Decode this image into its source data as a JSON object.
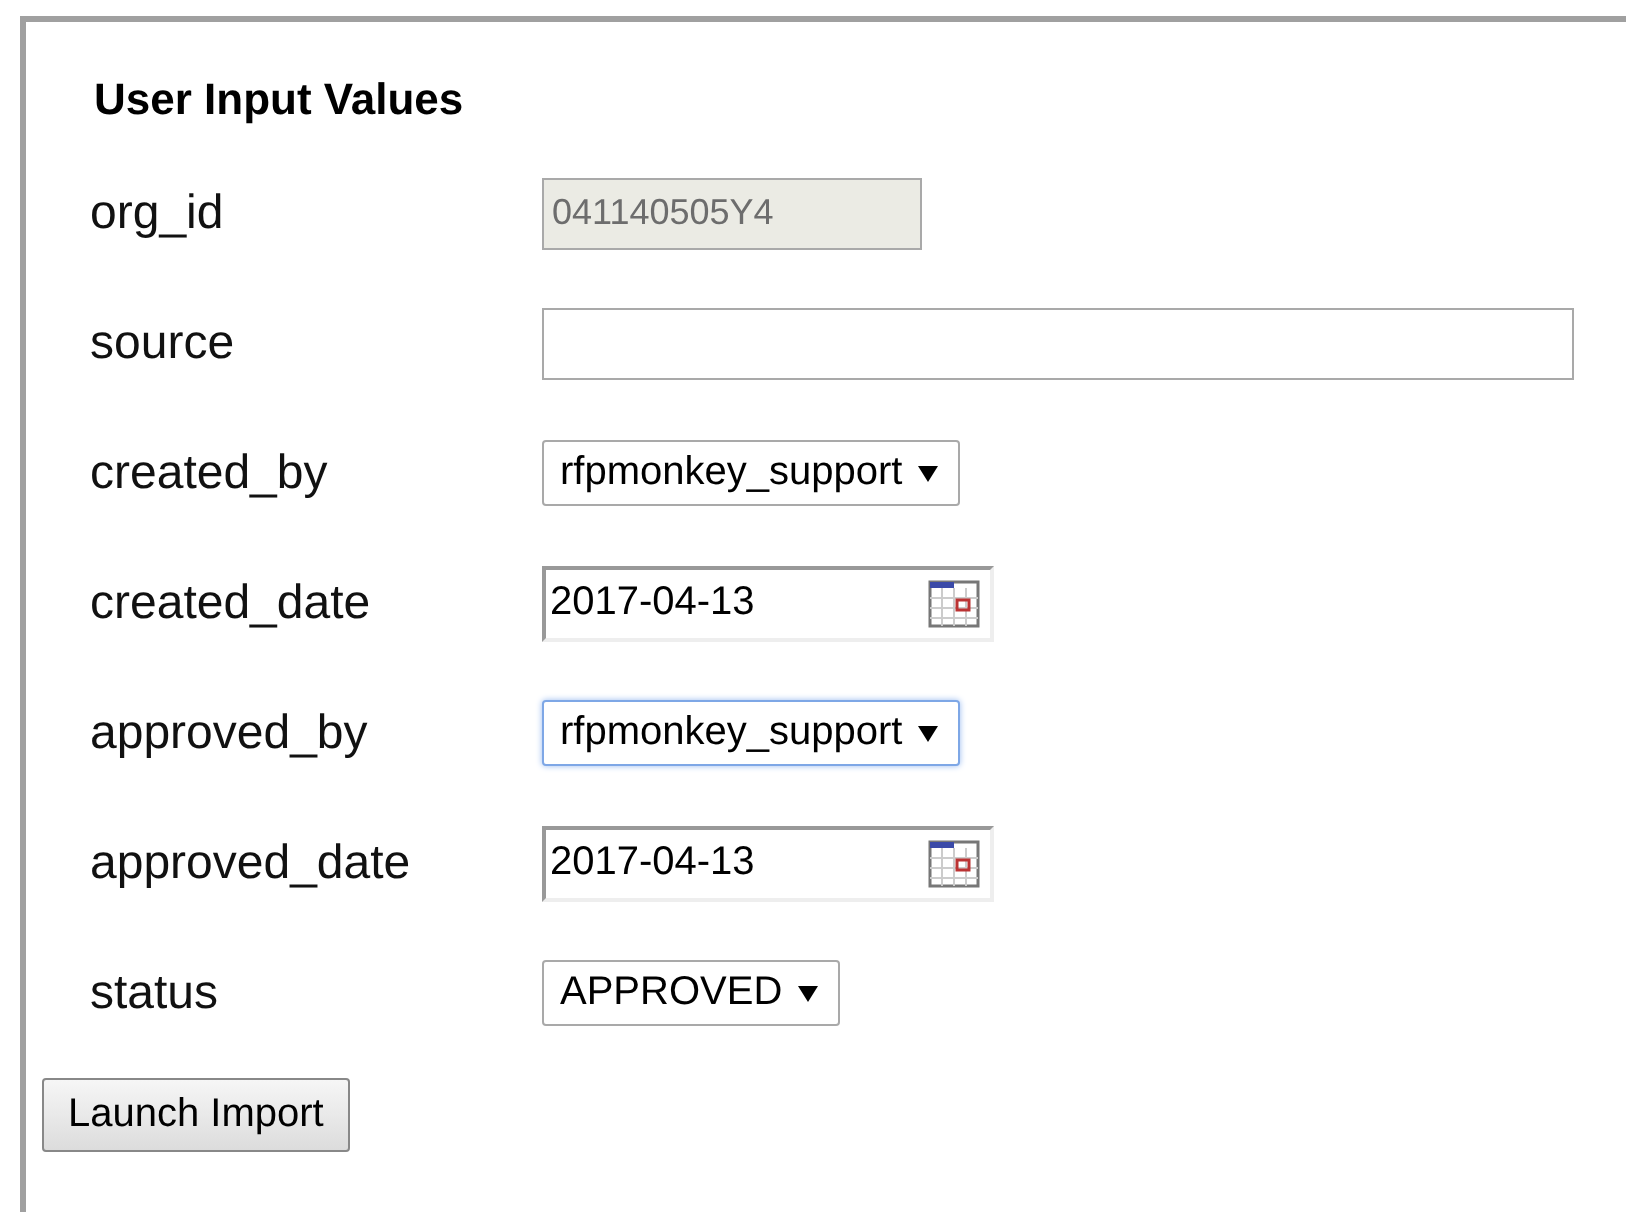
{
  "title": "User Input Values",
  "fields": [
    {
      "label": "org_id",
      "kind": "text",
      "value": "041140505Y4",
      "disabled": true
    },
    {
      "label": "source",
      "kind": "text",
      "disabled": false
    },
    {
      "label": "created_by",
      "kind": "select",
      "value": "rfpmonkey_support",
      "focused": false
    },
    {
      "label": "created_date",
      "kind": "date",
      "value": "2017-04-13"
    },
    {
      "label": "approved_by",
      "kind": "select",
      "value": "rfpmonkey_support",
      "focused": true
    },
    {
      "label": "approved_date",
      "kind": "date",
      "value": "2017-04-13"
    },
    {
      "label": "status",
      "kind": "select",
      "value": "APPROVED",
      "focused": false
    }
  ],
  "button": "Launch Import"
}
